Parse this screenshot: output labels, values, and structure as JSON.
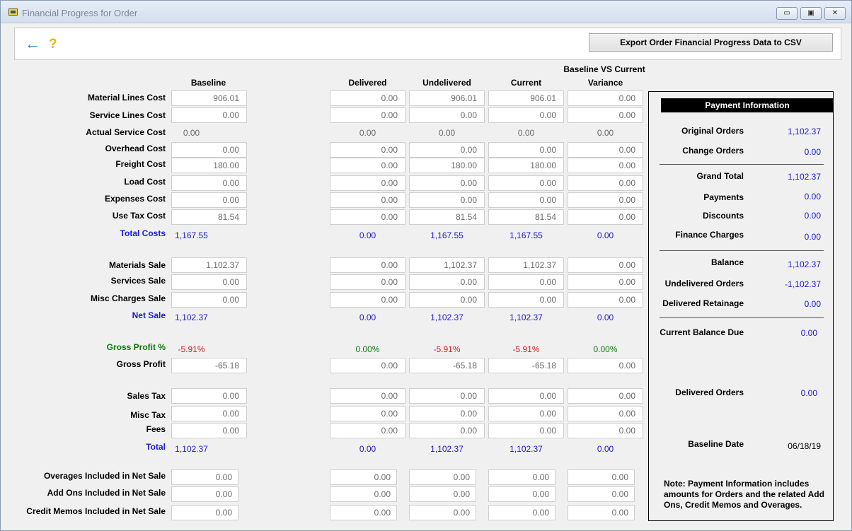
{
  "window": {
    "title": "Financial Progress for Order",
    "minimize_glyph": "▭",
    "maximize_glyph": "▣",
    "close_glyph": "✕"
  },
  "toolbar": {
    "back_icon": "←",
    "help_icon": "?",
    "export_label": "Export Order Financial Progress Data to CSV"
  },
  "columns": {
    "baseline": "Baseline",
    "delivered": "Delivered",
    "undelivered": "Undelivered",
    "current": "Current",
    "variance_top": "Baseline VS Current",
    "variance": "Variance"
  },
  "rows": {
    "material_lines_cost": {
      "label": "Material Lines Cost",
      "baseline": "906.01",
      "delivered": "0.00",
      "undelivered": "906.01",
      "current": "906.01",
      "variance": "0.00"
    },
    "service_lines_cost": {
      "label": "Service Lines Cost",
      "baseline": "0.00",
      "delivered": "0.00",
      "undelivered": "0.00",
      "current": "0.00",
      "variance": "0.00"
    },
    "actual_service_cost": {
      "label": "Actual Service Cost",
      "baseline": "0.00",
      "delivered": "0.00",
      "undelivered": "0.00",
      "current": "0.00",
      "variance": "0.00"
    },
    "overhead_cost": {
      "label": "Overhead Cost",
      "baseline": "0.00",
      "delivered": "0.00",
      "undelivered": "0.00",
      "current": "0.00",
      "variance": "0.00"
    },
    "freight_cost": {
      "label": "Freight Cost",
      "baseline": "180.00",
      "delivered": "0.00",
      "undelivered": "180.00",
      "current": "180.00",
      "variance": "0.00"
    },
    "load_cost": {
      "label": "Load Cost",
      "baseline": "0.00",
      "delivered": "0.00",
      "undelivered": "0.00",
      "current": "0.00",
      "variance": "0.00"
    },
    "expenses_cost": {
      "label": "Expenses Cost",
      "baseline": "0.00",
      "delivered": "0.00",
      "undelivered": "0.00",
      "current": "0.00",
      "variance": "0.00"
    },
    "use_tax_cost": {
      "label": "Use Tax Cost",
      "baseline": "81.54",
      "delivered": "0.00",
      "undelivered": "81.54",
      "current": "81.54",
      "variance": "0.00"
    },
    "total_costs": {
      "label": "Total Costs",
      "baseline": "1,167.55",
      "delivered": "0.00",
      "undelivered": "1,167.55",
      "current": "1,167.55",
      "variance": "0.00"
    },
    "materials_sale": {
      "label": "Materials Sale",
      "baseline": "1,102.37",
      "delivered": "0.00",
      "undelivered": "1,102.37",
      "current": "1,102.37",
      "variance": "0.00"
    },
    "services_sale": {
      "label": "Services Sale",
      "baseline": "0.00",
      "delivered": "0.00",
      "undelivered": "0.00",
      "current": "0.00",
      "variance": "0.00"
    },
    "misc_charges_sale": {
      "label": "Misc Charges Sale",
      "baseline": "0.00",
      "delivered": "0.00",
      "undelivered": "0.00",
      "current": "0.00",
      "variance": "0.00"
    },
    "net_sale": {
      "label": "Net Sale",
      "baseline": "1,102.37",
      "delivered": "0.00",
      "undelivered": "1,102.37",
      "current": "1,102.37",
      "variance": "0.00"
    },
    "gross_profit_pct": {
      "label": "Gross Profit %",
      "baseline": "-5.91%",
      "delivered": "0.00%",
      "undelivered": "-5.91%",
      "current": "-5.91%",
      "variance": "0.00%"
    },
    "gross_profit": {
      "label": "Gross Profit",
      "baseline": "-65.18",
      "delivered": "0.00",
      "undelivered": "-65.18",
      "current": "-65.18",
      "variance": "0.00"
    },
    "sales_tax": {
      "label": "Sales Tax",
      "baseline": "0.00",
      "delivered": "0.00",
      "undelivered": "0.00",
      "current": "0.00",
      "variance": "0.00"
    },
    "misc_tax": {
      "label": "Misc Tax",
      "baseline": "0.00",
      "delivered": "0.00",
      "undelivered": "0.00",
      "current": "0.00",
      "variance": "0.00"
    },
    "fees": {
      "label": "Fees",
      "baseline": "0.00",
      "delivered": "0.00",
      "undelivered": "0.00",
      "current": "0.00",
      "variance": "0.00"
    },
    "total": {
      "label": "Total",
      "baseline": "1,102.37",
      "delivered": "0.00",
      "undelivered": "1,102.37",
      "current": "1,102.37",
      "variance": "0.00"
    },
    "overages": {
      "label": "Overages Included in Net Sale",
      "baseline": "0.00",
      "delivered": "0.00",
      "undelivered": "0.00",
      "current": "0.00",
      "variance": "0.00"
    },
    "add_ons": {
      "label": "Add Ons Included in Net Sale",
      "baseline": "0.00",
      "delivered": "0.00",
      "undelivered": "0.00",
      "current": "0.00",
      "variance": "0.00"
    },
    "credit_memos": {
      "label": "Credit Memos Included in Net Sale",
      "baseline": "0.00",
      "delivered": "0.00",
      "undelivered": "0.00",
      "current": "0.00",
      "variance": "0.00"
    }
  },
  "payment": {
    "header": "Payment Information",
    "original_orders": {
      "label": "Original Orders",
      "value": "1,102.37"
    },
    "change_orders": {
      "label": "Change Orders",
      "value": "0.00"
    },
    "grand_total": {
      "label": "Grand Total",
      "value": "1,102.37"
    },
    "payments": {
      "label": "Payments",
      "value": "0.00"
    },
    "discounts": {
      "label": "Discounts",
      "value": "0.00"
    },
    "finance_charges": {
      "label": "Finance Charges",
      "value": "0.00"
    },
    "balance": {
      "label": "Balance",
      "value": "1,102.37"
    },
    "undelivered_orders": {
      "label": "Undelivered Orders",
      "value": "-1,102.37"
    },
    "delivered_retainage": {
      "label": "Delivered Retainage",
      "value": "0.00"
    },
    "current_balance_due": {
      "label": "Current Balance Due",
      "value": "0.00"
    },
    "delivered_orders": {
      "label": "Delivered Orders",
      "value": "0.00"
    },
    "baseline_date": {
      "label": "Baseline Date",
      "value": "06/18/19"
    },
    "note": "Note:  Payment Information includes amounts for Orders and the related Add Ons, Credit Memos and Overages."
  }
}
